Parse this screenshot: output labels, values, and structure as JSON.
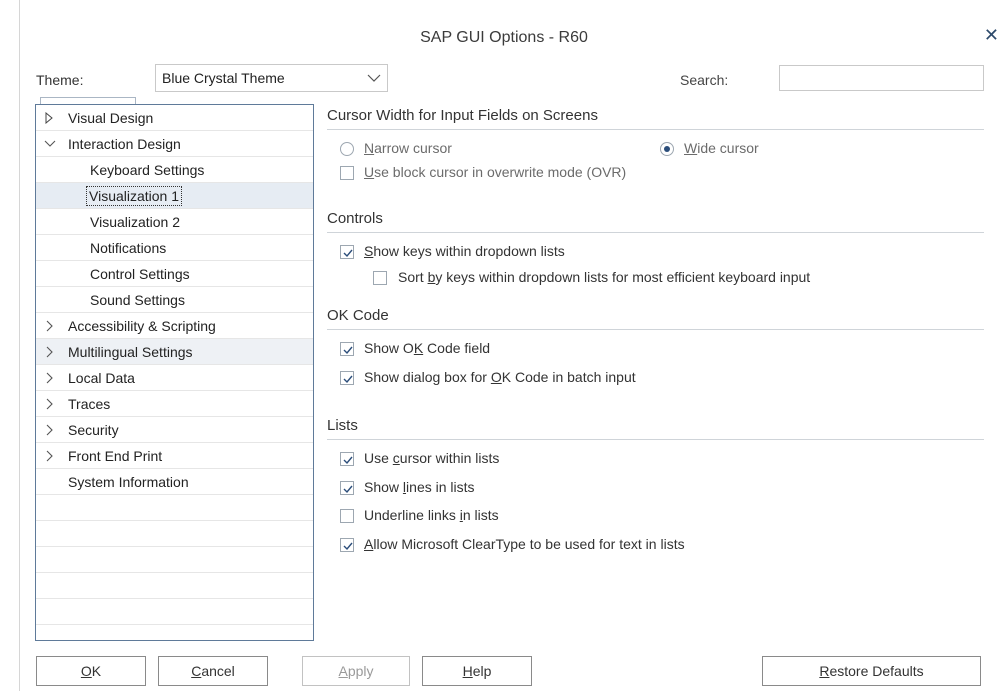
{
  "window": {
    "title": "SAP GUI Options - R60",
    "close_glyph": "✕"
  },
  "theme": {
    "label": "Theme:",
    "value": "Blue Crystal Theme"
  },
  "search": {
    "label": "Search:",
    "value": ""
  },
  "tree": {
    "items": [
      {
        "label": "Visual Design",
        "indent": 0,
        "twisty": "collapsed-selected"
      },
      {
        "label": "Interaction Design",
        "indent": 0,
        "twisty": "expanded"
      },
      {
        "label": "Keyboard Settings",
        "indent": 1
      },
      {
        "label": "Visualization 1",
        "indent": 1,
        "selected": true
      },
      {
        "label": "Visualization 2",
        "indent": 1
      },
      {
        "label": "Notifications",
        "indent": 1
      },
      {
        "label": "Control Settings",
        "indent": 1
      },
      {
        "label": "Sound Settings",
        "indent": 1
      },
      {
        "label": "Accessibility & Scripting",
        "indent": 0,
        "twisty": "collapsed"
      },
      {
        "label": "Multilingual Settings",
        "indent": 0,
        "twisty": "collapsed",
        "hover": true
      },
      {
        "label": "Local Data",
        "indent": 0,
        "twisty": "collapsed"
      },
      {
        "label": "Traces",
        "indent": 0,
        "twisty": "collapsed"
      },
      {
        "label": "Security",
        "indent": 0,
        "twisty": "collapsed"
      },
      {
        "label": "Front End Print",
        "indent": 0,
        "twisty": "collapsed"
      },
      {
        "label": "System Information",
        "indent": 0
      }
    ]
  },
  "cursor_section": {
    "title": "Cursor Width for Input Fields on Screens",
    "narrow": {
      "mnemonic": "N",
      "rest": "arrow cursor",
      "selected": false
    },
    "wide": {
      "mnemonic": "W",
      "rest": "ide cursor",
      "selected": true
    },
    "block": {
      "mnemonic": "U",
      "rest": "se block cursor in overwrite mode (OVR)",
      "checked": false
    }
  },
  "controls_section": {
    "title": "Controls",
    "show_keys": {
      "mnemonic": "S",
      "rest": "how keys within dropdown lists",
      "checked": true
    },
    "sort_keys": {
      "pre": "Sort ",
      "mnemonic": "b",
      "rest": "y keys within dropdown lists for most efficient keyboard input",
      "checked": false
    }
  },
  "okcode_section": {
    "title": "OK Code",
    "show_field": {
      "pre": "Show O",
      "mnemonic": "K",
      "rest": " Code field",
      "checked": true
    },
    "show_dialog": {
      "pre": "Show dialog box for ",
      "mnemonic": "O",
      "rest": "K Code in batch input",
      "checked": true
    }
  },
  "lists_section": {
    "title": "Lists",
    "use_cursor": {
      "pre": "Use ",
      "mnemonic": "c",
      "rest": "ursor within lists",
      "checked": true
    },
    "show_lines": {
      "pre": "Show ",
      "mnemonic": "l",
      "rest": "ines in lists",
      "checked": true
    },
    "underline_links": {
      "pre": "Underline links ",
      "mnemonic": "i",
      "rest": "n lists",
      "checked": false
    },
    "cleartype": {
      "pre": "",
      "mnemonic": "A",
      "rest": "llow Microsoft ClearType to be used for text in lists",
      "checked": true
    }
  },
  "buttons": {
    "ok": {
      "mnemonic": "O",
      "rest": "K"
    },
    "cancel": {
      "mnemonic": "C",
      "rest": "ancel"
    },
    "apply": {
      "mnemonic": "A",
      "rest": "pply",
      "disabled": true
    },
    "help": {
      "mnemonic": "H",
      "rest": "elp"
    },
    "restore": {
      "mnemonic": "R",
      "rest": "estore Defaults"
    }
  },
  "colors": {
    "accent": "#2b4d7a",
    "tree_border": "#5f7a99",
    "selection": "#e6ecf3"
  }
}
